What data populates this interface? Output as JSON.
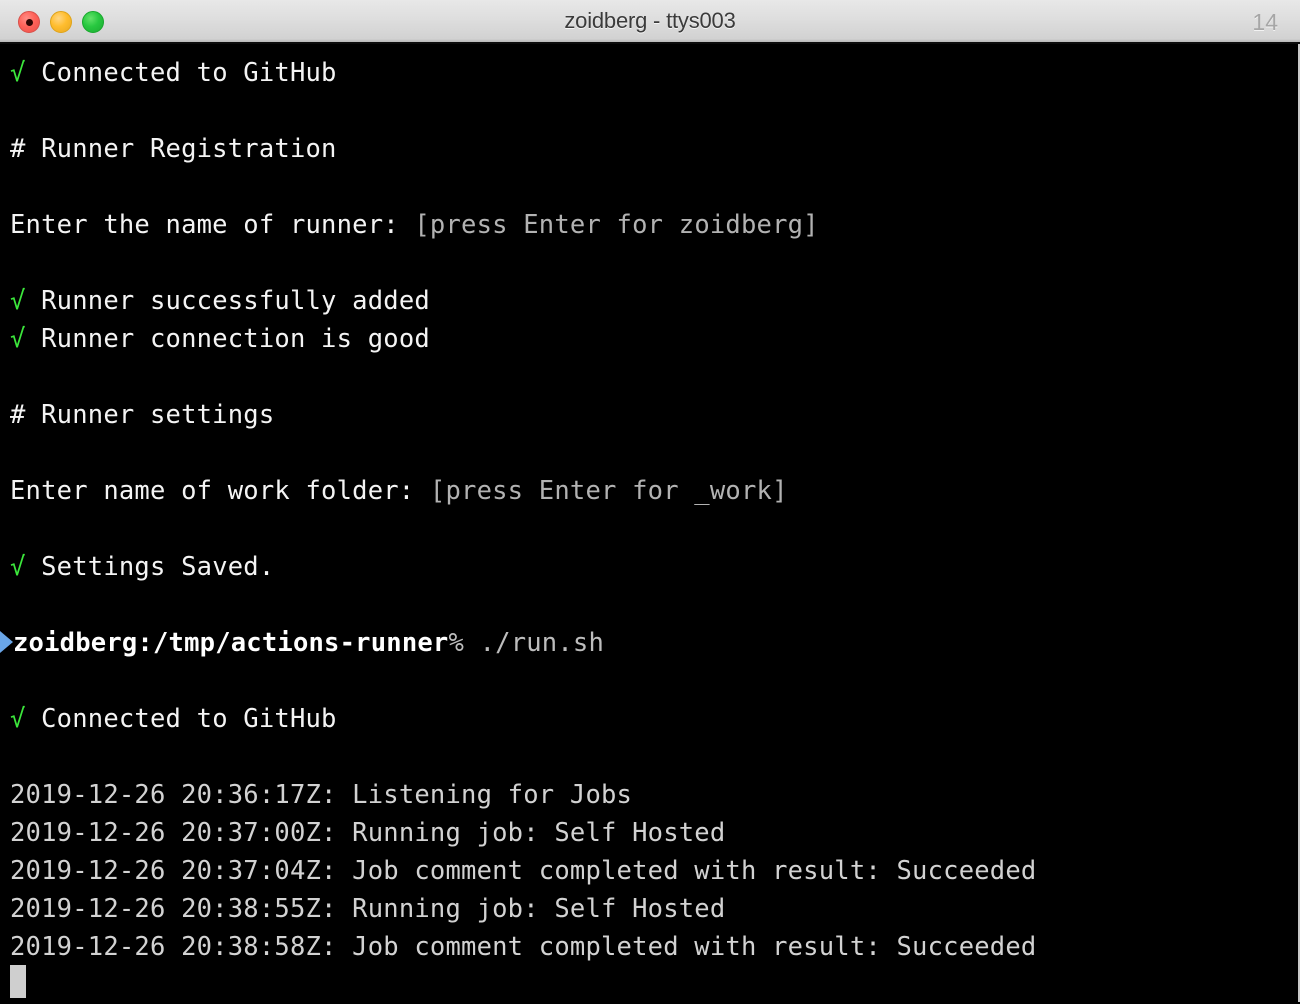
{
  "window": {
    "title": "zoidberg - ttys003",
    "tab_count": "14",
    "controls": {
      "close_label": "Close",
      "minimize_label": "Minimize",
      "zoom_label": "Zoom"
    }
  },
  "theme": {
    "background": "#000000",
    "foreground": "#f2f2f2",
    "dim_foreground": "#b2b2b2",
    "log_foreground": "#d2d2d2",
    "success_green": "#3ce83c",
    "prompt_arrow_blue": "#6aa6e8",
    "cursor": "#cfcfcf",
    "titlebar_text": "#3b3b3b"
  },
  "terminal": {
    "check_glyph": "√",
    "lines": [
      {
        "id": "l01",
        "check": "√",
        "text": " Connected to GitHub"
      },
      {
        "id": "l02",
        "text": ""
      },
      {
        "id": "l03",
        "text": "# Runner Registration"
      },
      {
        "id": "l04",
        "text": ""
      },
      {
        "id": "l05",
        "text": "Enter the name of runner: ",
        "hint": "[press Enter for zoidberg]"
      },
      {
        "id": "l06",
        "text": ""
      },
      {
        "id": "l07",
        "check": "√",
        "text": " Runner successfully added"
      },
      {
        "id": "l08",
        "check": "√",
        "text": " Runner connection is good"
      },
      {
        "id": "l09",
        "text": ""
      },
      {
        "id": "l10",
        "text": "# Runner settings"
      },
      {
        "id": "l11",
        "text": ""
      },
      {
        "id": "l12",
        "text": "Enter name of work folder: ",
        "hint": "[press Enter for _work]"
      },
      {
        "id": "l13",
        "text": ""
      },
      {
        "id": "l14",
        "check": "√",
        "text": " Settings Saved."
      },
      {
        "id": "l15",
        "text": ""
      }
    ],
    "prompt": {
      "host": "zoidberg",
      "separator": ":",
      "path": "/tmp/actions-runner",
      "symbol": "%",
      "command": " ./run.sh"
    },
    "after_prompt": [
      {
        "id": "a01",
        "text": ""
      },
      {
        "id": "a02",
        "check": "√",
        "text": " Connected to GitHub"
      },
      {
        "id": "a03",
        "text": ""
      }
    ],
    "log_lines": [
      {
        "id": "g01",
        "timestamp": "2019-12-26 20:36:17Z",
        "message": "Listening for Jobs"
      },
      {
        "id": "g02",
        "timestamp": "2019-12-26 20:37:00Z",
        "message": "Running job: Self Hosted"
      },
      {
        "id": "g03",
        "timestamp": "2019-12-26 20:37:04Z",
        "message": "Job comment completed with result: Succeeded"
      },
      {
        "id": "g04",
        "timestamp": "2019-12-26 20:38:55Z",
        "message": "Running job: Self Hosted"
      },
      {
        "id": "g05",
        "timestamp": "2019-12-26 20:38:58Z",
        "message": "Job comment completed with result: Succeeded"
      }
    ]
  }
}
